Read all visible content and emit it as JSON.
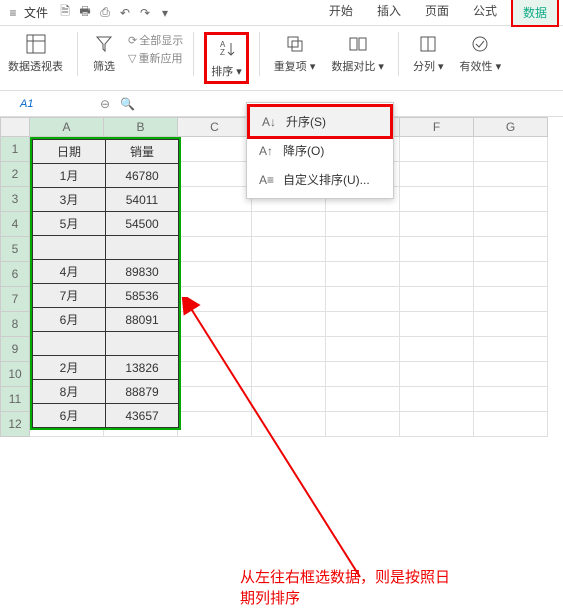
{
  "menubar": {
    "file": "文件",
    "tabs": [
      "开始",
      "插入",
      "页面",
      "公式",
      "数据"
    ]
  },
  "ribbon": {
    "pivot": "数据透视表",
    "filter": "筛选",
    "show_all": "全部显示",
    "reapply": "重新应用",
    "sort": "排序",
    "dup": "重复项",
    "compare": "数据对比",
    "split": "分列",
    "validate": "有效性"
  },
  "dropdown": {
    "asc": "升序(S)",
    "desc": "降序(O)",
    "custom": "自定义排序(U)..."
  },
  "namebox": "A1",
  "col_headers": [
    "A",
    "B",
    "C",
    "D",
    "E",
    "F",
    "G"
  ],
  "row_headers": [
    "1",
    "2",
    "3",
    "4",
    "5",
    "6",
    "7",
    "8",
    "9",
    "10",
    "11",
    "12"
  ],
  "table": {
    "headers": [
      "日期",
      "销量"
    ],
    "rows": [
      [
        "1月",
        "46780"
      ],
      [
        "3月",
        "54011"
      ],
      [
        "5月",
        "54500"
      ],
      [
        "",
        ""
      ],
      [
        "4月",
        "89830"
      ],
      [
        "7月",
        "58536"
      ],
      [
        "6月",
        "88091"
      ],
      [
        "",
        ""
      ],
      [
        "2月",
        "13826"
      ],
      [
        "8月",
        "88879"
      ],
      [
        "6月",
        "43657"
      ]
    ]
  },
  "annotation": {
    "line1": "从左往右框选数据，则是按照日",
    "line2": "期列排序"
  },
  "chart_data": {
    "type": "table",
    "title": "",
    "columns": [
      "日期",
      "销量"
    ],
    "rows": [
      {
        "日期": "1月",
        "销量": 46780
      },
      {
        "日期": "3月",
        "销量": 54011
      },
      {
        "日期": "5月",
        "销量": 54500
      },
      {
        "日期": "",
        "销量": null
      },
      {
        "日期": "4月",
        "销量": 89830
      },
      {
        "日期": "7月",
        "销量": 58536
      },
      {
        "日期": "6月",
        "销量": 88091
      },
      {
        "日期": "",
        "销量": null
      },
      {
        "日期": "2月",
        "销量": 13826
      },
      {
        "日期": "8月",
        "销量": 88879
      },
      {
        "日期": "6月",
        "销量": 43657
      }
    ]
  }
}
